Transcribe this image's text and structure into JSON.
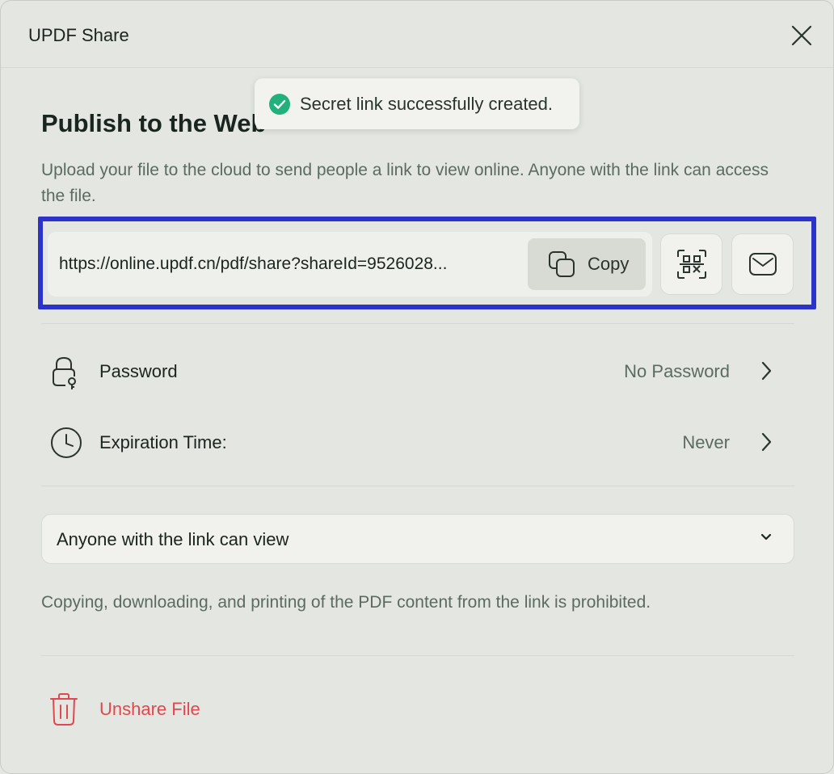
{
  "window": {
    "title": "UPDF Share",
    "close_icon": "close-icon"
  },
  "toast": {
    "icon": "check-circle-icon",
    "message": "Secret link successfully created.",
    "icon_color": "#22b07d"
  },
  "main": {
    "heading": "Publish to the Web",
    "description": "Upload your file to the cloud to send people a link to view online. Anyone with the link can access the file."
  },
  "link": {
    "url": "https://online.updf.cn/pdf/share?shareId=9526028...",
    "copy_label": "Copy",
    "copy_icon": "copy-icon",
    "qr_icon": "qr-code-icon",
    "email_icon": "email-icon",
    "highlight_color": "#2b33c9"
  },
  "settings": [
    {
      "label": "Password",
      "value": "No Password",
      "icon": "lock-icon"
    },
    {
      "label": "Expiration Time:",
      "value": "Never",
      "icon": "clock-icon"
    }
  ],
  "access": {
    "selected": "Anyone with the link can view"
  },
  "note": "Copying, downloading, and printing of the PDF content from the link is prohibited.",
  "unshare": {
    "label": "Unshare File",
    "icon": "trash-icon",
    "color": "#e0484d"
  }
}
